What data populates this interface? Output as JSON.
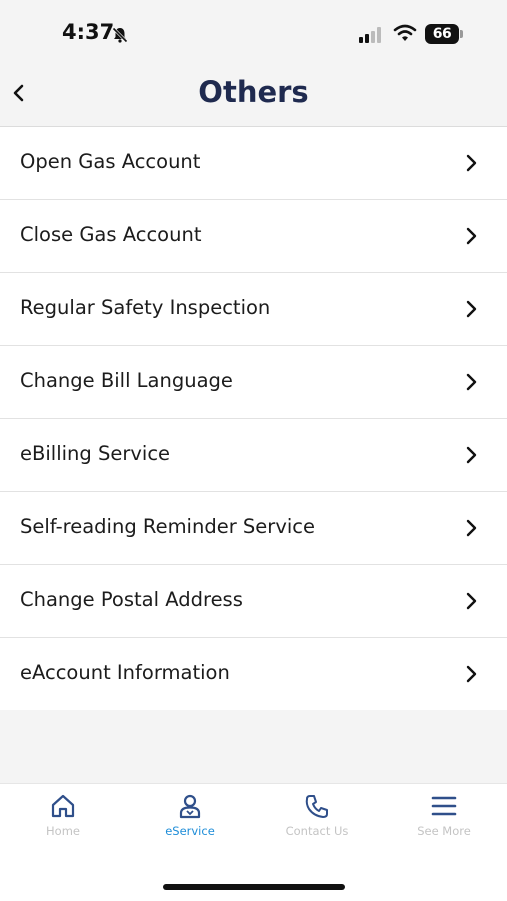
{
  "status_bar": {
    "time": "4:37",
    "battery": "66"
  },
  "header": {
    "title": "Others"
  },
  "menu": [
    {
      "label": "Open Gas Account"
    },
    {
      "label": "Close Gas Account"
    },
    {
      "label": "Regular Safety Inspection"
    },
    {
      "label": "Change Bill Language"
    },
    {
      "label": "eBilling Service"
    },
    {
      "label": "Self-reading Reminder Service"
    },
    {
      "label": "Change Postal Address"
    },
    {
      "label": "eAccount Information"
    }
  ],
  "tabs": [
    {
      "label": "Home",
      "icon": "home-icon",
      "active": false
    },
    {
      "label": "eService",
      "icon": "person-icon",
      "active": true
    },
    {
      "label": "Contact Us",
      "icon": "phone-icon",
      "active": false
    },
    {
      "label": "See More",
      "icon": "hamburger-icon",
      "active": false
    }
  ],
  "colors": {
    "title": "#1f2a4f",
    "active_tab": "#1e8dd8",
    "inactive_tab": "#c4c4c4",
    "tab_icon": "#2f4f8a"
  }
}
